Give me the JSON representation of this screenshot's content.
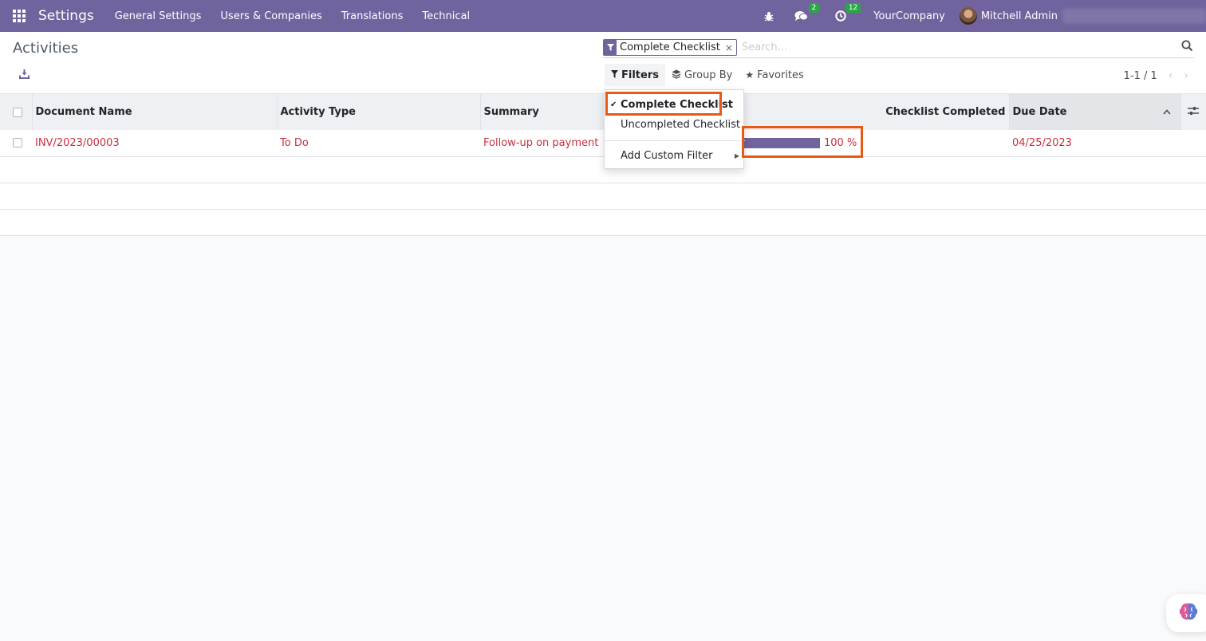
{
  "navbar": {
    "app_name": "Settings",
    "menu": [
      "General Settings",
      "Users & Companies",
      "Translations",
      "Technical"
    ],
    "messages_count": "2",
    "activities_count": "12",
    "company": "YourCompany",
    "user": "Mitchell Admin"
  },
  "control_panel": {
    "title": "Activities",
    "search": {
      "facet_label": "Complete Checklist",
      "facet_remove": "×",
      "placeholder": "Search..."
    },
    "buttons": {
      "filters": "Filters",
      "group_by": "Group By",
      "favorites": "Favorites"
    },
    "pager": "1-1 / 1"
  },
  "filters_dropdown": {
    "items": [
      {
        "label": "Complete Checklist",
        "checked": true
      },
      {
        "label": "Uncompleted Checklist",
        "checked": false
      }
    ],
    "custom_filter": "Add Custom Filter"
  },
  "table": {
    "columns": [
      "Document Name",
      "Activity Type",
      "Summary",
      "Checklist Completed",
      "Due Date"
    ],
    "rows": [
      {
        "document_name": "INV/2023/00003",
        "activity_type": "To Do",
        "summary": "Follow-up on payment",
        "progress_percent": 100,
        "progress_label": "100 %",
        "due_date": "04/25/2023"
      }
    ]
  },
  "colors": {
    "brand": "#71639e",
    "overdue_text": "#c9303e",
    "highlight": "#e65a13",
    "badge": "#28a745"
  }
}
